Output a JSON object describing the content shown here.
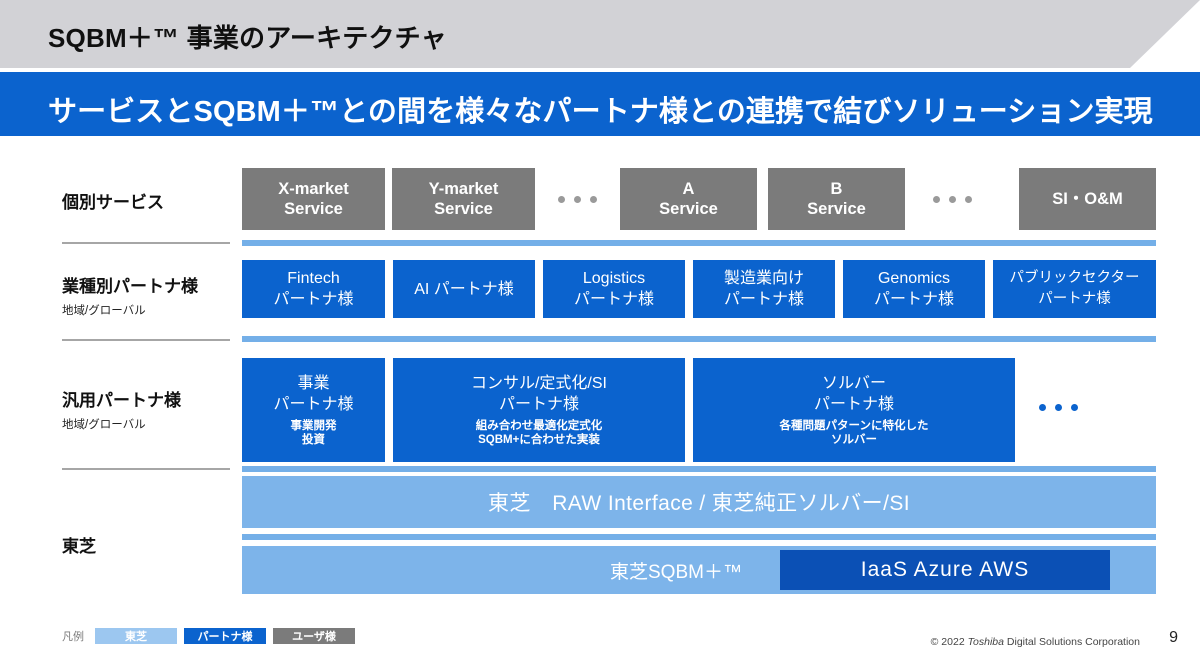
{
  "header": {
    "title": "SQBM＋™ 事業のアーキテクチャ",
    "banner": "サービスとSQBM＋™との間を様々なパートナ様との連携で結びソリューション実現",
    "bg_color": "#d2d2d6",
    "banner_color": "#0b63ce"
  },
  "rows": [
    {
      "label": "個別サービス",
      "sublabel": "",
      "boxes": [
        {
          "l1": "X-market",
          "l2": "Service"
        },
        {
          "l1": "Y-market",
          "l2": "Service"
        },
        {
          "l1": "A",
          "l2": "Service"
        },
        {
          "l1": "B",
          "l2": "Service"
        },
        {
          "l1": "SI・O&M",
          "l2": ""
        }
      ]
    },
    {
      "label": "業種別パートナ様",
      "sublabel": "地域/グローバル",
      "boxes": [
        {
          "l1": "Fintech",
          "l2": "パートナ様"
        },
        {
          "l1": "AI パートナ様",
          "l2": ""
        },
        {
          "l1": "Logistics",
          "l2": "パートナ様"
        },
        {
          "l1": "製造業向け",
          "l2": "パートナ様"
        },
        {
          "l1": "Genomics",
          "l2": "パートナ様"
        },
        {
          "l1": "パブリックセクター",
          "l2": "パートナ様"
        }
      ]
    },
    {
      "label": "汎用パートナ様",
      "sublabel": "地域/グローバル",
      "boxes": [
        {
          "l1": "事業",
          "l2": "パートナ様",
          "l3": "事業開発",
          "l4": "投資"
        },
        {
          "l1": "コンサル/定式化/SI",
          "l2": "パートナ様",
          "l3": "組み合わせ最適化定式化",
          "l4": "SQBM+に合わせた実装"
        },
        {
          "l1": "ソルバー",
          "l2": "パートナ様",
          "l3": "各種問題パターンに特化した",
          "l4": "ソルバー"
        }
      ]
    },
    {
      "label": "東芝",
      "sublabel": "",
      "band_interface": "東芝　RAW Interface / 東芝純正ソルバー/SI",
      "band_sqbm_label": "東芝SQBM＋™",
      "band_iaas": "IaaS  Azure  AWS"
    }
  ],
  "legend": {
    "caption": "凡例",
    "items": [
      {
        "label": "東芝",
        "color": "#9cc7f0"
      },
      {
        "label": "パートナ様",
        "color": "#0b63ce"
      },
      {
        "label": "ユーザ様",
        "color": "#7b7b7b"
      }
    ]
  },
  "footer": {
    "copyright_pre": "© 2022 ",
    "copyright_brand": "Toshiba",
    "copyright_post": " Digital Solutions Corporation",
    "page_number": "9"
  }
}
